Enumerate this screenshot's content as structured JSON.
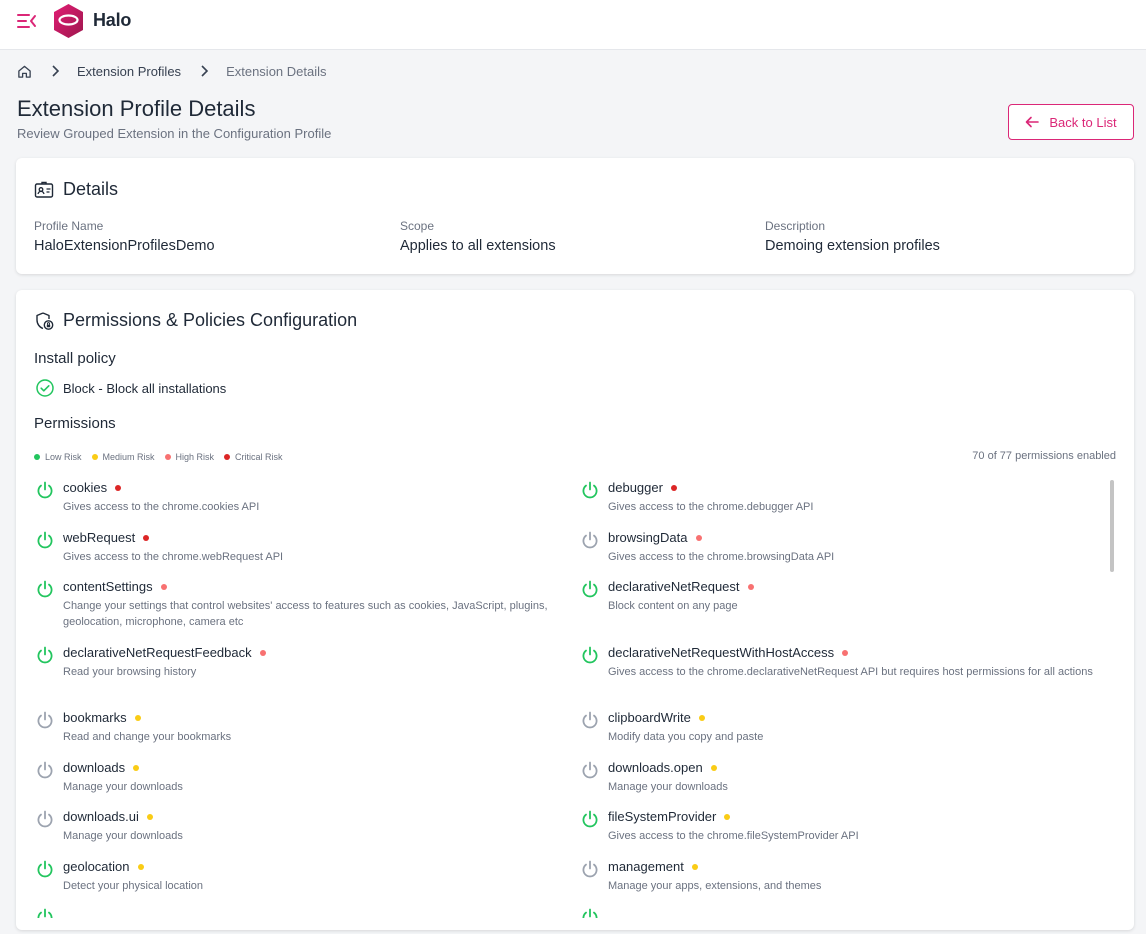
{
  "app": {
    "brand": "Halo"
  },
  "breadcrumb": {
    "items": [
      "Extension Profiles",
      "Extension Details"
    ]
  },
  "page": {
    "title": "Extension Profile Details",
    "subtitle": "Review Grouped Extension in the Configuration Profile",
    "back_label": "Back to List"
  },
  "details": {
    "header": "Details",
    "profile_name_label": "Profile Name",
    "profile_name": "HaloExtensionProfilesDemo",
    "scope_label": "Scope",
    "scope": "Applies to all extensions",
    "description_label": "Description",
    "description": "Demoing extension profiles"
  },
  "permissions_section": {
    "header": "Permissions & Policies Configuration",
    "install_policy_title": "Install policy",
    "install_policy_value": "Block - Block all installations",
    "permissions_title": "Permissions",
    "legend": [
      {
        "label": "Low Risk",
        "color": "#22c55e"
      },
      {
        "label": "Medium Risk",
        "color": "#facc15"
      },
      {
        "label": "High Risk",
        "color": "#f87171"
      },
      {
        "label": "Critical Risk",
        "color": "#dc2626"
      }
    ],
    "count_text": "70 of 77 permissions enabled"
  },
  "colors": {
    "accent": "#db2777",
    "enabled": "#22c55e",
    "disabled": "#9ca3af",
    "low": "#22c55e",
    "medium": "#facc15",
    "high": "#f87171",
    "critical": "#dc2626"
  },
  "permissions": [
    {
      "name": "cookies",
      "desc": "Gives access to the chrome.cookies API",
      "risk": "critical",
      "enabled": true
    },
    {
      "name": "debugger",
      "desc": "Gives access to the chrome.debugger API",
      "risk": "critical",
      "enabled": true
    },
    {
      "name": "webRequest",
      "desc": "Gives access to the chrome.webRequest API",
      "risk": "critical",
      "enabled": true
    },
    {
      "name": "browsingData",
      "desc": "Gives access to the chrome.browsingData API",
      "risk": "high",
      "enabled": false
    },
    {
      "name": "contentSettings",
      "desc": "Change your settings that control websites' access to features such as cookies, JavaScript, plugins, geolocation, microphone, camera etc",
      "risk": "high",
      "enabled": true
    },
    {
      "name": "declarativeNetRequest",
      "desc": "Block content on any page",
      "risk": "high",
      "enabled": true
    },
    {
      "name": "declarativeNetRequestFeedback",
      "desc": "Read your browsing history",
      "risk": "high",
      "enabled": true
    },
    {
      "name": "declarativeNetRequestWithHostAccess",
      "desc": "Gives access to the chrome.declarativeNetRequest API but requires host permissions for all actions",
      "risk": "high",
      "enabled": true
    },
    {
      "name": "bookmarks",
      "desc": "Read and change your bookmarks",
      "risk": "medium",
      "enabled": false
    },
    {
      "name": "clipboardWrite",
      "desc": "Modify data you copy and paste",
      "risk": "medium",
      "enabled": false
    },
    {
      "name": "downloads",
      "desc": "Manage your downloads",
      "risk": "medium",
      "enabled": false
    },
    {
      "name": "downloads.open",
      "desc": "Manage your downloads",
      "risk": "medium",
      "enabled": false
    },
    {
      "name": "downloads.ui",
      "desc": "Manage your downloads",
      "risk": "medium",
      "enabled": false
    },
    {
      "name": "fileSystemProvider",
      "desc": "Gives access to the chrome.fileSystemProvider API",
      "risk": "medium",
      "enabled": true
    },
    {
      "name": "geolocation",
      "desc": "Detect your physical location",
      "risk": "medium",
      "enabled": true
    },
    {
      "name": "management",
      "desc": "Manage your apps, extensions, and themes",
      "risk": "medium",
      "enabled": false
    }
  ]
}
